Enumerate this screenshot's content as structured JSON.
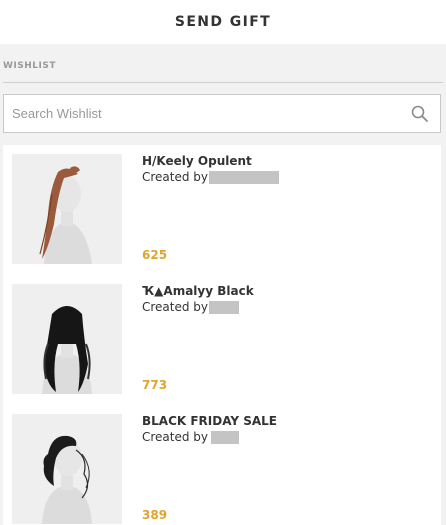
{
  "header": {
    "title": "SEND GIFT"
  },
  "wishlist": {
    "section_label": "WISHLIST"
  },
  "search": {
    "placeholder": "Search Wishlist",
    "value": "",
    "icon": "search-icon"
  },
  "items": [
    {
      "name": "H/Keely Opulent",
      "created_by_label": "Created by",
      "price": "625",
      "hair_color": "#9a5a3c"
    },
    {
      "name": "Ҡ▲Amalyy Black",
      "created_by_label": "Created by",
      "price": "773",
      "hair_color": "#161616"
    },
    {
      "name": "BLACK FRIDAY SALE",
      "created_by_label": "Created by",
      "price": "389",
      "hair_color": "#1c1c1c"
    }
  ],
  "colors": {
    "price": "#e0a52a",
    "background": "#f2f2f2",
    "redaction": "#c4c4c4"
  }
}
